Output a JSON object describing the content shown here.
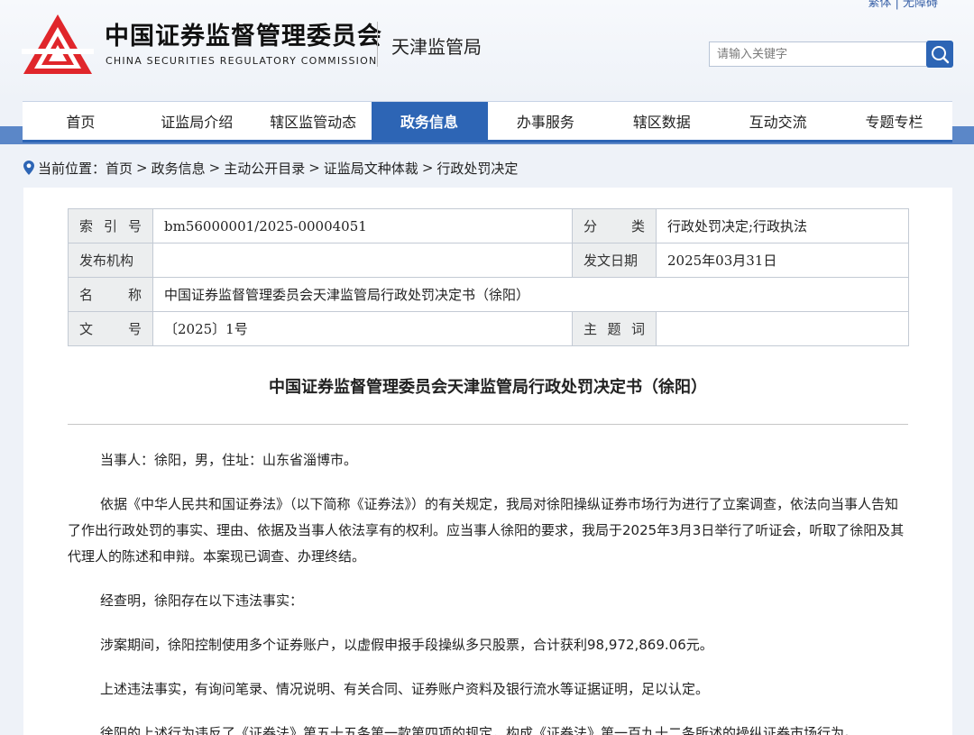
{
  "header": {
    "top_links": "繁体 | 无障碍",
    "org_name_cn": "中国证券监督管理委员会",
    "org_name_en": "CHINA SECURITIES REGULATORY COMMISSION",
    "bureau_name": "天津监管局",
    "search_placeholder": "请输入关键字",
    "brand_red": "#e0262b",
    "brand_blue": "#2d65b5"
  },
  "nav": {
    "items": [
      {
        "label": "首页"
      },
      {
        "label": "证监局介绍"
      },
      {
        "label": "辖区监管动态"
      },
      {
        "label": "政务信息"
      },
      {
        "label": "办事服务"
      },
      {
        "label": "辖区数据"
      },
      {
        "label": "互动交流"
      },
      {
        "label": "专题专栏"
      }
    ],
    "active_index": 3
  },
  "breadcrumb": {
    "prefix": "当前位置：",
    "items": [
      "首页",
      "政务信息",
      "主动公开目录",
      "证监局文种体裁",
      "行政处罚决定"
    ],
    "separator": ">"
  },
  "meta": {
    "index_label": "索引号",
    "index_value": "bm56000001/2025-00004051",
    "category_label": "分类",
    "category_value": "行政处罚决定;行政执法",
    "publisher_label": "发布机构",
    "publisher_value": "",
    "date_label": "发文日期",
    "date_value": "2025年03月31日",
    "name_label": "名称",
    "name_value": "中国证券监督管理委员会天津监管局行政处罚决定书（徐阳）",
    "docno_label": "文号",
    "docno_value": "〔2025〕1号",
    "subject_label": "主题词",
    "subject_value": ""
  },
  "document": {
    "title": "中国证券监督管理委员会天津监管局行政处罚决定书（徐阳）",
    "paragraphs": [
      "当事人：徐阳，男，住址：山东省淄博市。",
      "依据《中华人民共和国证券法》（以下简称《证券法》）的有关规定，我局对徐阳操纵证券市场行为进行了立案调查，依法向当事人告知了作出行政处罚的事实、理由、依据及当事人依法享有的权利。应当事人徐阳的要求，我局于2025年3月3日举行了听证会，听取了徐阳及其代理人的陈述和申辩。本案现已调查、办理终结。",
      "经查明，徐阳存在以下违法事实：",
      "涉案期间，徐阳控制使用多个证券账户，以虚假申报手段操纵多只股票，合计获利98,972,869.06元。",
      "上述违法事实，有询问笔录、情况说明、有关合同、证券账户资料及银行流水等证据证明，足以认定。",
      "徐阳的上述行为违反了《证券法》第五十五条第一款第四项的规定，构成《证券法》第一百九十二条所述的操纵证券市场行为。"
    ]
  }
}
